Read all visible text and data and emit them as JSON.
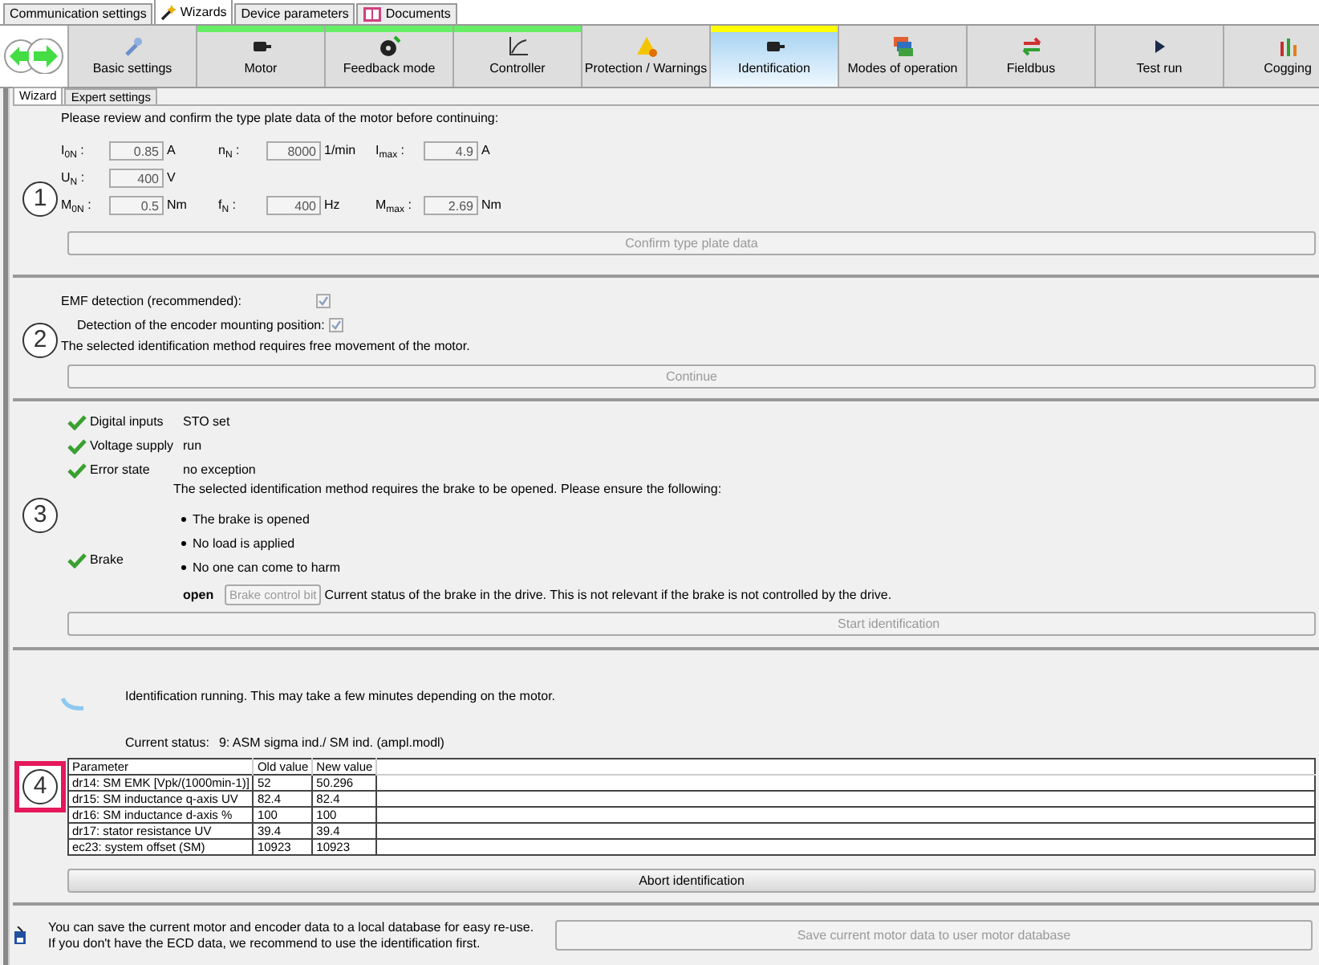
{
  "top_tabs": [
    {
      "label": "Communication settings",
      "selected": false
    },
    {
      "label": "Wizards",
      "selected": true
    },
    {
      "label": "Device parameters",
      "selected": false
    },
    {
      "label": "Documents",
      "selected": false
    }
  ],
  "steps": [
    {
      "label": "Basic settings",
      "selected": false,
      "completed": false
    },
    {
      "label": "Motor",
      "selected": false,
      "completed": true
    },
    {
      "label": "Feedback mode",
      "selected": false,
      "completed": true
    },
    {
      "label": "Controller",
      "selected": false,
      "completed": true
    },
    {
      "label": "Protection / Warnings",
      "selected": false,
      "completed": false
    },
    {
      "label": "Identification",
      "selected": true,
      "completed": false
    },
    {
      "label": "Modes of operation",
      "selected": false,
      "completed": false
    },
    {
      "label": "Fieldbus",
      "selected": false,
      "completed": false
    },
    {
      "label": "Test run",
      "selected": false,
      "completed": false
    },
    {
      "label": "Cogging",
      "selected": false,
      "completed": false
    }
  ],
  "sub_tabs": [
    {
      "label": "Wizard",
      "selected": true
    },
    {
      "label": "Expert settings",
      "selected": false
    }
  ],
  "section_1": {
    "number": "1",
    "highlighted": false,
    "intro": "Please review and confirm the type plate data of the motor before continuing:",
    "rows": [
      [
        {
          "label": "I$_{0N}$ :",
          "value": "0.85",
          "unit": "A"
        },
        {
          "label": "n$_{N}$ :",
          "value": "8000",
          "unit": "1/min"
        },
        {
          "label": "I$_{max}$ :",
          "value": "4.9",
          "unit": "A"
        }
      ],
      [
        {
          "label": "U$_{N}$ :",
          "value": "400",
          "unit": "V"
        }
      ],
      [
        {
          "label": "M$_{0N}$ :",
          "value": "0.5",
          "unit": "Nm"
        },
        {
          "label": "f$_{N}$ :",
          "value": "400",
          "unit": "Hz"
        },
        {
          "label": "M$_{max}$ :",
          "value": "2.69",
          "unit": "Nm"
        }
      ]
    ],
    "button": {
      "label": "Confirm type plate data",
      "disabled": true
    }
  },
  "section_2": {
    "number": "2",
    "highlighted": false,
    "options": [
      {
        "label": "EMF detection (recommended):",
        "checked": true
      },
      {
        "label": "Detection of the encoder mounting position:",
        "checked": true
      }
    ],
    "note": "The selected identification method requires free movement of the motor.",
    "button": {
      "label": "Continue",
      "disabled": true
    }
  },
  "section_3": {
    "number": "3",
    "highlighted": false,
    "checks": [
      {
        "label": "Digital inputs",
        "ok": true,
        "value": "STO set"
      },
      {
        "label": "Voltage supply",
        "ok": true,
        "value": "run"
      },
      {
        "label": "Error state",
        "ok": true,
        "value": "no exception"
      }
    ],
    "brake": {
      "label": "Brake",
      "ok": true,
      "intro": "The selected identification method requires the brake to be opened. Please ensure the following:",
      "bullets": [
        "The brake is opened",
        "No load is applied",
        "No one can come to harm"
      ],
      "status": "open",
      "control_button": "Brake control bit",
      "status_note": "Current status of the brake in the drive. This is not relevant if the brake is not controlled by the drive."
    },
    "button": {
      "label": "Start identification",
      "disabled": true
    }
  },
  "section_4": {
    "number": "4",
    "highlighted": true,
    "running": "Identification running. This may take a few minutes depending on the motor.",
    "status_label": "Current status:",
    "status_value": "9: ASM sigma ind./ SM ind. (ampl.modl)",
    "table": {
      "columns": [
        "Parameter",
        "Old value",
        "New value"
      ],
      "rows": [
        [
          "dr14: SM EMK [Vpk/(1000min-1)]",
          "52",
          "50.296"
        ],
        [
          "dr15: SM inductance q-axis UV",
          "82.4",
          "82.4"
        ],
        [
          "dr16: SM inductance d-axis %",
          "100",
          "100"
        ],
        [
          "dr17: stator resistance UV",
          "39.4",
          "39.4"
        ],
        [
          "ec23: system offset (SM)",
          "10923",
          "10923"
        ]
      ]
    },
    "button": {
      "label": "Abort identification",
      "disabled": false
    }
  },
  "footer": {
    "lines": [
      "You can save the current motor and encoder data to a local database for easy re-use.",
      "If you don't have the ECD data, we recommend to use the identification first."
    ],
    "button": {
      "label": "Save current motor data to user motor database",
      "disabled": true
    }
  }
}
